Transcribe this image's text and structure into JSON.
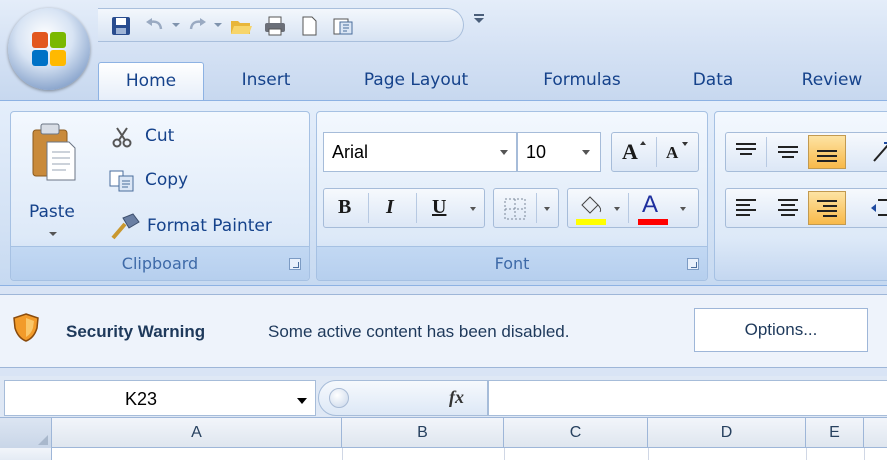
{
  "quick_access": {
    "icons": [
      "save-icon",
      "undo-icon",
      "redo-icon",
      "open-folder-icon",
      "print-icon",
      "new-document-icon",
      "publish-icon"
    ],
    "customize_label": "="
  },
  "tabs": [
    {
      "label": "Home",
      "active": true
    },
    {
      "label": "Insert",
      "active": false
    },
    {
      "label": "Page Layout",
      "active": false
    },
    {
      "label": "Formulas",
      "active": false
    },
    {
      "label": "Data",
      "active": false
    },
    {
      "label": "Review",
      "active": false
    }
  ],
  "clipboard": {
    "paste_label": "Paste",
    "cut_label": "Cut",
    "copy_label": "Copy",
    "format_painter_label": "Format Painter",
    "group_label": "Clipboard"
  },
  "font": {
    "font_name": "Arial",
    "font_size": "10",
    "grow_label": "A",
    "shrink_label": "A",
    "bold_label": "B",
    "italic_label": "I",
    "underline_label": "U",
    "font_color_label": "A",
    "group_label": "Font",
    "fill_color": "#ffff00",
    "font_color": "#ff0000"
  },
  "security_warning": {
    "title": "Security Warning",
    "message": "Some active content has been disabled.",
    "options_label": "Options..."
  },
  "formula_bar": {
    "name_box": "K23",
    "fx_label": "fx",
    "formula": ""
  },
  "columns": [
    "A",
    "B",
    "C",
    "D",
    "E"
  ]
}
